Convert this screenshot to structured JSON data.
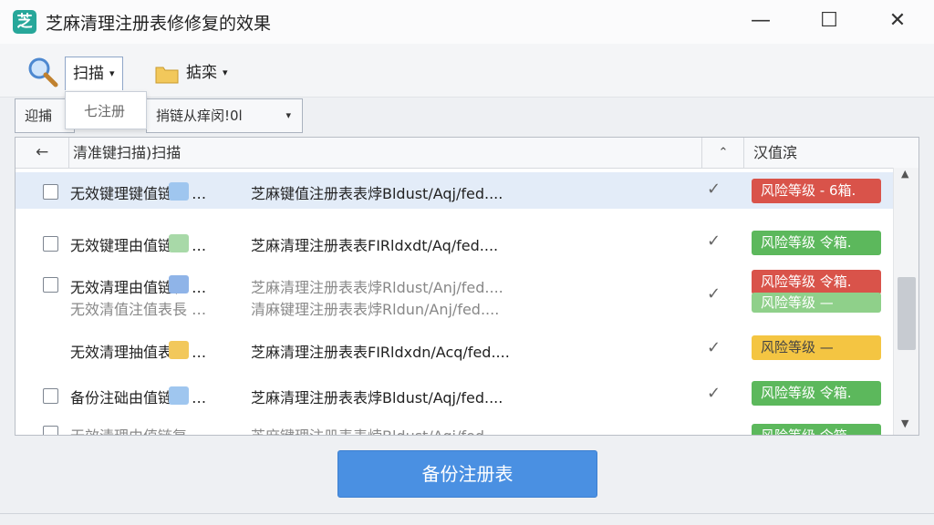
{
  "window": {
    "icon_glyph": "芝",
    "title": "芝麻清理注册表修修复的效果",
    "minimize": "—",
    "maximize": "☐",
    "close": "✕"
  },
  "toolbar": {
    "search_icon": "search-icon",
    "scan_label": "扫描",
    "clean_label": "掂栾",
    "caret": "▾"
  },
  "scan_menu": {
    "item": "七注册"
  },
  "subtabs": {
    "tab1": "迎捕",
    "tab2": "捎链从痒闵!0l",
    "caret": "▾"
  },
  "table": {
    "back_glyph": "←",
    "col_name": "清准键扫描)扫描",
    "sort_glyph": "⌃",
    "col_risk": "汉值滨",
    "rows": [
      {
        "name": "无效键理键值链表 …",
        "path": "芝麻键值注册表表㶿Bldust/Aqj/fed....",
        "check": "✓",
        "badge": "风险等级 - 6箱.",
        "badge_color": "red",
        "selected": true
      },
      {
        "name": "无效键理由值链表 …",
        "path": "芝麻清理注册表表FIRldxdt/Aq/fed....",
        "check": "✓",
        "badge": "风险等级 令箱.",
        "badge_color": "green"
      },
      {
        "name": "无效清理由值链表 …",
        "name2": "无效清值注值表長 …",
        "path": "芝麻清理注册表表㶿Rldust/Anj/fed....",
        "path2": "清麻键理注册表表㶿Rldun/Anj/fed....",
        "check": "✓",
        "badge": "风险等级 令箱.",
        "badge_color": "red",
        "badge2": "风险等级 —",
        "badge2_color": "green"
      },
      {
        "name": "无效清理抽值表长 …",
        "path": "芝麻清理注册表表FIRldxdn/Acq/fed....",
        "check": "✓",
        "badge": "风险等级 —",
        "badge_color": "yellow"
      },
      {
        "name": "备份注础由值链表 …",
        "path": "芝麻清理注册表表㶿Bldust/Aqj/fed....",
        "check": "✓",
        "badge": "风险等级 令箱.",
        "badge_color": "green"
      },
      {
        "name": "无效清理由值链复",
        "path": "芝麻键理注册表表㶿Bldust/Aqj/fed....",
        "badge": "风险等级 令箱.",
        "badge_color": "green"
      }
    ]
  },
  "footer": {
    "backup_button": "备份注册表"
  },
  "colors": {
    "red": "#d9534a",
    "green": "#5cb85c",
    "yellow": "#f4c542",
    "accent": "#4a90e2"
  }
}
